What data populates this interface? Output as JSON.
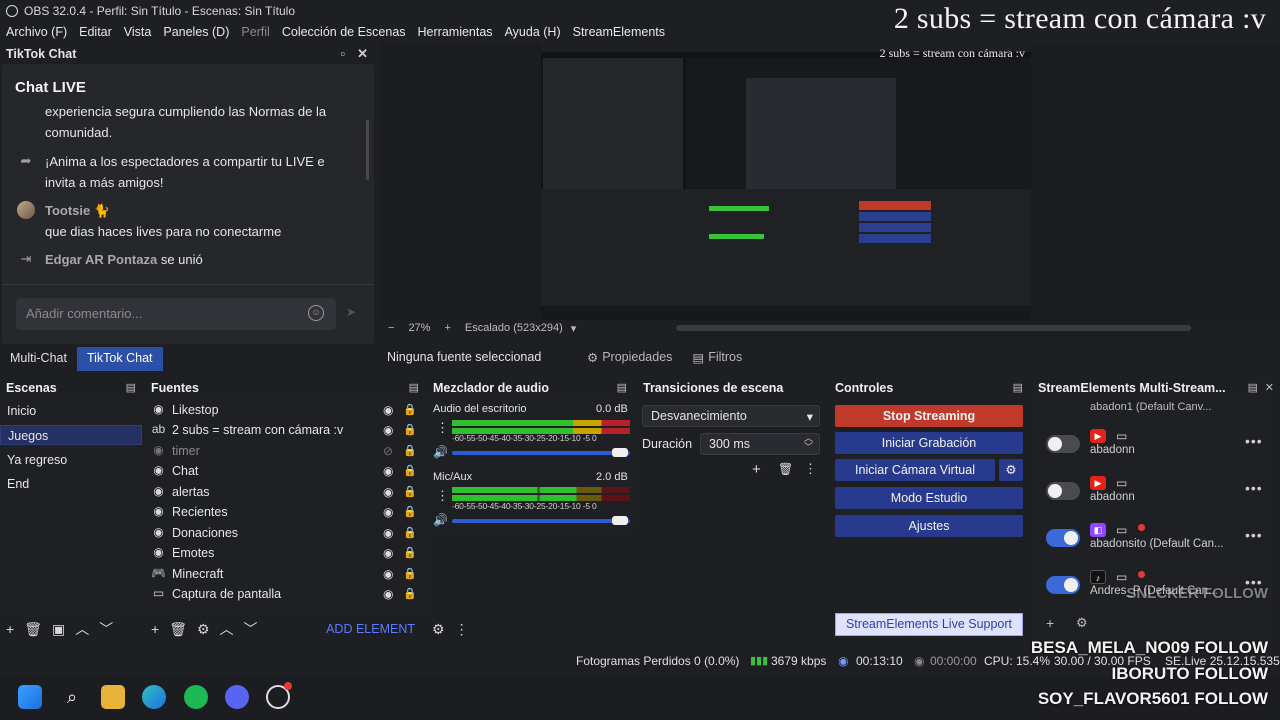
{
  "window": {
    "title": "OBS 32.0.4 - Perfil: Sin Título - Escenas: Sin Título"
  },
  "menu": [
    "Archivo (F)",
    "Editar",
    "Vista",
    "Paneles (D)",
    "Perfil",
    "Colección de Escenas",
    "Herramientas",
    "Ayuda (H)",
    "StreamElements"
  ],
  "overlay_title": "2 subs = stream con cámara :v",
  "tiktok": {
    "dock_title": "TikTok Chat",
    "live_title": "Chat LIVE",
    "messages": [
      {
        "text": "experiencia segura cumpliendo las Normas de la"
      },
      {
        "text": "comunidad."
      },
      {
        "text": "¡Anima a los espectadores a compartir tu LIVE e"
      },
      {
        "text": "invita a más amigos!"
      },
      {
        "user": "Tootsie",
        "text": "que dias haces lives para no conectarme"
      },
      {
        "user": "Edgar AR Pontaza",
        "text": "se unió"
      }
    ],
    "input_placeholder": "Añadir comentario..."
  },
  "tabs": [
    "Multi-Chat",
    "TikTok Chat"
  ],
  "preview": {
    "zoom": "27%",
    "scale": "Escalado (523x294)",
    "mini_text": "2 subs = stream con cámara :v"
  },
  "source_bar": {
    "no_source": "Ninguna fuente seleccionad",
    "properties": "Propiedades",
    "filters": "Filtros"
  },
  "scenes": {
    "title": "Escenas",
    "items": [
      "Inicio",
      "Juegos",
      "Ya regreso",
      "End"
    ],
    "selected": "Juegos"
  },
  "sources": {
    "title": "Fuentes",
    "items": [
      "Likestop",
      "2 subs = stream con cámara :v",
      "timer",
      "Chat",
      "alertas",
      "Recientes",
      "Donaciones",
      "Emotes",
      "Minecraft",
      "Captura de pantalla"
    ],
    "add_element": "ADD ELEMENT"
  },
  "mixer": {
    "title": "Mezclador de audio",
    "channels": [
      {
        "name": "Audio del escritorio",
        "db": "0.0 dB"
      },
      {
        "name": "Mic/Aux",
        "db": "2.0 dB"
      }
    ],
    "ticks": "-60-55-50-45-40-35-30-25-20-15-10 -5  0"
  },
  "transitions": {
    "title": "Transiciones de escena",
    "type": "Desvanecimiento",
    "duration_label": "Duración",
    "duration": "300 ms"
  },
  "controls": {
    "title": "Controles",
    "stop": "Stop Streaming",
    "record": "Iniciar Grabación",
    "vcam": "Iniciar Cámara Virtual",
    "studio": "Modo Estudio",
    "settings": "Ajustes",
    "support": "StreamElements Live Support"
  },
  "streamelements": {
    "title": "StreamElements Multi-Stream...",
    "top_partial": "abadon1 (Default Canv...",
    "rows": [
      {
        "platform": "youtube",
        "name": "abadonn",
        "on": false
      },
      {
        "platform": "youtube",
        "name": "abadonn",
        "on": false
      },
      {
        "platform": "twitch",
        "name": "abadonsito (Default Can...",
        "on": true
      },
      {
        "platform": "tiktok",
        "name": "Andres_P (Default Can...",
        "on": true
      }
    ]
  },
  "status": {
    "dropped": "Fotogramas Perdidos 0 (0.0%)",
    "kbps": "3679 kbps",
    "stream_time": "00:13:10",
    "rec_time": "00:00:00",
    "cpu": "CPU: 15.4%",
    "fps": "30.00 / 30.00 FPS",
    "se": "SE.Live 25.12.15.535"
  },
  "follows": [
    "SNLCKER FOLLOW",
    "BESA_MELA_NO09 FOLLOW",
    "IBORUTO FOLLOW",
    "SOY_FLAVOR5601 FOLLOW"
  ],
  "colors": {
    "accent": "#283a8d",
    "stop": "#c0392b",
    "tab_active": "#2c4fa8"
  }
}
